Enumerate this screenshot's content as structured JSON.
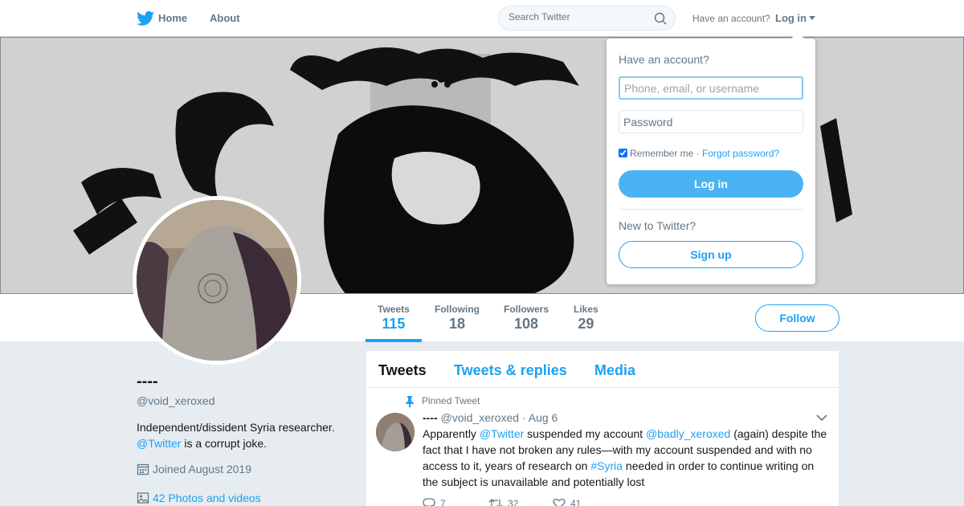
{
  "nav": {
    "logo_icon": "twitter-bird-icon",
    "home_label": "Home",
    "about_label": "About",
    "search_placeholder": "Search Twitter",
    "have_account": "Have an account?",
    "login_label": "Log in"
  },
  "profile": {
    "display_name": "----",
    "handle": "@void_xeroxed",
    "bio_text": "Independent/dissident Syria researcher.",
    "bio_mention": "@Twitter",
    "bio_rest": "is a corrupt joke.",
    "joined": "Joined August 2019",
    "photos": "42 Photos and videos",
    "follow_label": "Follow"
  },
  "stats": [
    {
      "label": "Tweets",
      "value": "115"
    },
    {
      "label": "Following",
      "value": "18"
    },
    {
      "label": "Followers",
      "value": "108"
    },
    {
      "label": "Likes",
      "value": "29"
    }
  ],
  "timeline": {
    "tabs": [
      "Tweets",
      "Tweets & replies",
      "Media"
    ],
    "pinned_label": "Pinned Tweet",
    "tweet": {
      "name": "----",
      "handle": "@void_xeroxed",
      "sep": "·",
      "date": "Aug 6",
      "t1": "Apparently ",
      "m1": "@Twitter",
      "t2": " suspended my account ",
      "m2": "@badly_xeroxed",
      "t3": " (again) despite the fact that I have not broken any rules—with my account suspended and with no access to it, years of research on ",
      "m3": "#Syria",
      "t4": " needed in order to continue writing on the subject is unavailable and potentially lost",
      "replies": "7",
      "retweets": "32",
      "likes": "41"
    }
  },
  "login_dropdown": {
    "title": "Have an account?",
    "user_placeholder": "Phone, email, or username",
    "password_placeholder": "Password",
    "remember": "Remember me",
    "sep": "·",
    "forgot": "Forgot password?",
    "login_button": "Log in",
    "new_to": "New to Twitter?",
    "signup_button": "Sign up"
  },
  "colors": {
    "accent": "#1da1f2",
    "button_fill": "#4ab3f4",
    "background": "#e6ecf0"
  }
}
